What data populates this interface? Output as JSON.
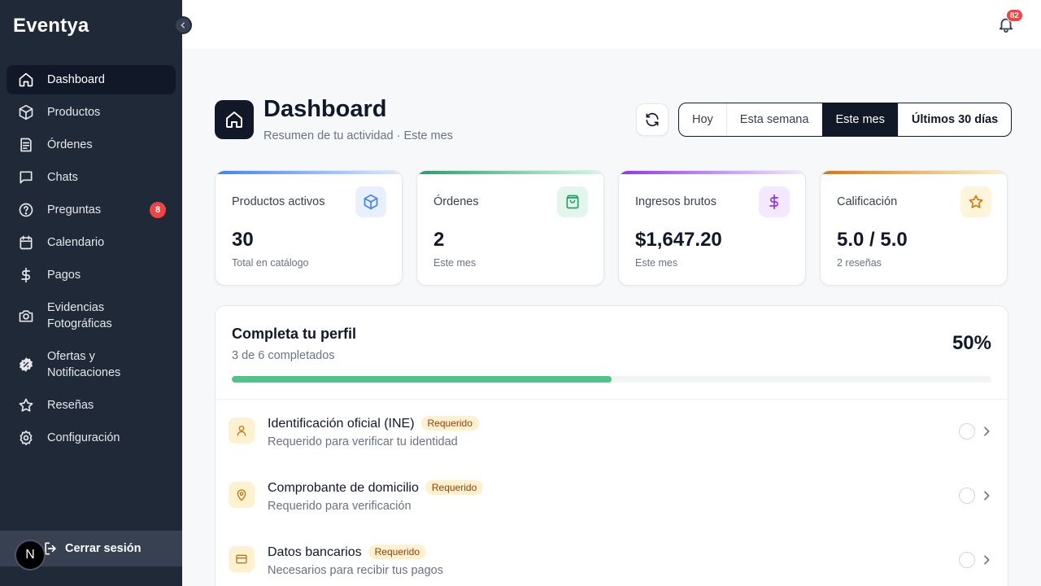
{
  "app": {
    "brand": "Eventya"
  },
  "sidebar": {
    "items": [
      {
        "label": "Dashboard",
        "icon": "home-icon",
        "active": true
      },
      {
        "label": "Productos",
        "icon": "box-icon"
      },
      {
        "label": "Órdenes",
        "icon": "receipt-icon"
      },
      {
        "label": "Chats",
        "icon": "chat-icon"
      },
      {
        "label": "Preguntas",
        "icon": "help-circle-icon",
        "badge": "8"
      },
      {
        "label": "Calendario",
        "icon": "calendar-icon"
      },
      {
        "label": "Pagos",
        "icon": "dollar-icon"
      },
      {
        "label": "Evidencias Fotográficas",
        "icon": "camera-icon"
      },
      {
        "label": "Ofertas y Notificaciones",
        "icon": "badge-percent-icon"
      },
      {
        "label": "Reseñas",
        "icon": "star-icon"
      },
      {
        "label": "Configuración",
        "icon": "settings-icon"
      }
    ],
    "logout_label": "Cerrar sesión",
    "avatar_initial": "N"
  },
  "topbar": {
    "notifications_count": "82"
  },
  "header": {
    "title": "Dashboard",
    "subtitle": "Resumen de tu actividad · Este mes",
    "ranges": [
      "Hoy",
      "Esta semana",
      "Este mes",
      "Últimos 30 días"
    ],
    "selected_range": "Este mes"
  },
  "stats": [
    {
      "label": "Productos activos",
      "value": "30",
      "sub": "Total en catálogo",
      "icon": "box-icon",
      "color": "#3b82f6"
    },
    {
      "label": "Órdenes",
      "value": "2",
      "sub": "Este mes",
      "icon": "shopping-bag-icon",
      "color": "#22a06b"
    },
    {
      "label": "Ingresos brutos",
      "value": "$1,647.20",
      "sub": "Este mes",
      "icon": "dollar-icon",
      "color": "#9333ea"
    },
    {
      "label": "Calificación",
      "value": "5.0 / 5.0",
      "sub": "2 reseñas",
      "icon": "star-icon",
      "color": "#d97706"
    }
  ],
  "profile": {
    "title": "Completa tu perfil",
    "subtitle": "3 de 6 completados",
    "percent_label": "50%",
    "progress": 0.5,
    "tasks": [
      {
        "title": "Identificación oficial (INE)",
        "badge": "Requerido",
        "desc": "Requerido para verificar tu identidad",
        "icon": "user-icon"
      },
      {
        "title": "Comprobante de domicilio",
        "badge": "Requerido",
        "desc": "Requerido para verificación",
        "icon": "map-pin-icon"
      },
      {
        "title": "Datos bancarios",
        "badge": "Requerido",
        "desc": "Necesarios para recibir tus pagos",
        "icon": "credit-card-icon"
      }
    ]
  }
}
